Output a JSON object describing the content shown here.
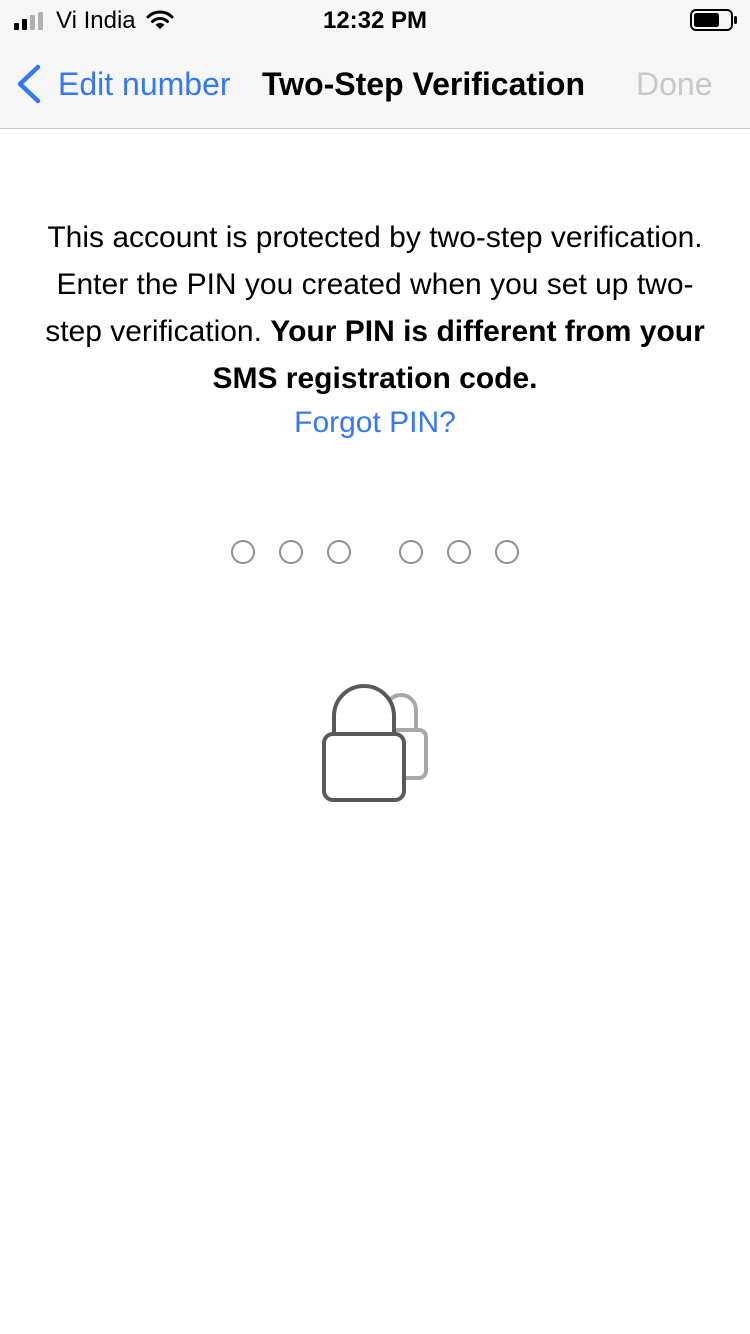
{
  "status_bar": {
    "carrier": "Vi India",
    "time": "12:32 PM",
    "signal_icon": "cellular-signal-icon",
    "wifi_icon": "wifi-icon",
    "battery_icon": "battery-icon"
  },
  "nav": {
    "back_label": "Edit number",
    "title": "Two-Step Verification",
    "done_label": "Done"
  },
  "content": {
    "instructions_regular": "This account is protected by two-step verification. Enter the PIN you created when you set up two-step verification. ",
    "instructions_bold": "Your PIN is different from your SMS registration code.",
    "forgot_link": "Forgot PIN?"
  },
  "pin": {
    "length": 6,
    "entered": 0
  },
  "icons": {
    "lock": "lock-icon"
  },
  "colors": {
    "accent": "#3478f6",
    "disabled": "#c7c7cc",
    "bar_background": "#f6f6f6",
    "pin_dot_border": "#8e8e93"
  }
}
